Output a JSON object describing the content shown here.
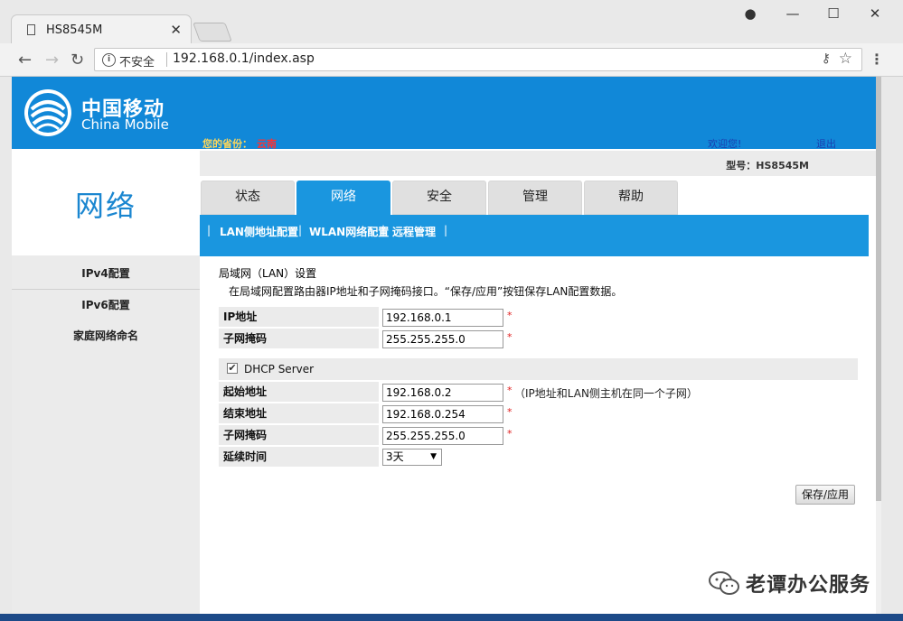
{
  "browser": {
    "tab_title": "HS8545M",
    "not_secure": "不安全",
    "url": "192.168.0.1/index.asp"
  },
  "header": {
    "logo_cn": "中国移动",
    "logo_en": "China Mobile",
    "province_label": "您的省份：",
    "province_value": "云南",
    "welcome": "欢迎您!",
    "logout": "退出"
  },
  "sidebar": {
    "title": "网络",
    "items": [
      "IPv4配置",
      "IPv6配置",
      "家庭网络命名"
    ]
  },
  "model": "型号：HS8545M",
  "tabs": [
    "状态",
    "网络",
    "安全",
    "管理",
    "帮助"
  ],
  "subnav": {
    "items": [
      "LAN侧地址配置",
      "WLAN网络配置",
      "远程管理"
    ],
    "pipe": "|"
  },
  "content": {
    "title": "局域网（LAN）设置",
    "description": "在局域网配置路由器IP地址和子网掩码接口。“保存/应用”按钮保存LAN配置数据。",
    "ip_label": "IP地址",
    "ip_value": "192.168.0.1",
    "mask_label": "子网掩码",
    "mask_value": "255.255.255.0",
    "dhcp_label": "DHCP Server",
    "start_label": "起始地址",
    "start_value": "192.168.0.2",
    "end_label": "结束地址",
    "end_value": "192.168.0.254",
    "dhcp_mask_label": "子网掩码",
    "dhcp_mask_value": "255.255.255.0",
    "lease_label": "延续时间",
    "lease_value": "3天",
    "required_mark": "*",
    "ip_note": "（IP地址和LAN侧主机在同一个子网）",
    "save_button": "保存/应用"
  },
  "watermark": "老谭办公服务"
}
